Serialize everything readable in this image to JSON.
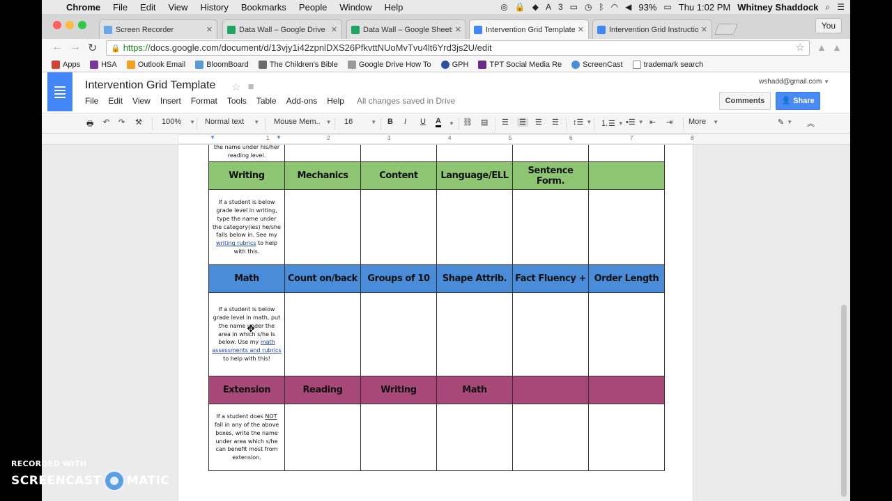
{
  "mac_menubar": {
    "app_name": "Chrome",
    "items": [
      "File",
      "Edit",
      "View",
      "History",
      "Bookmarks",
      "People",
      "Window",
      "Help"
    ],
    "status_badge": "3",
    "battery": "93%",
    "clock": "Thu 1:02 PM",
    "user": "Whitney Shaddock"
  },
  "tabs": [
    {
      "label": "Screen Recorder",
      "icon": "web-icon",
      "color": "#6aa6e8"
    },
    {
      "label": "Data Wall – Google Drive",
      "icon": "drive-icon",
      "color": "#1fa463"
    },
    {
      "label": "Data Wall – Google Sheets",
      "icon": "sheets-icon",
      "color": "#21a366"
    },
    {
      "label": "Intervention Grid Template",
      "icon": "docs-icon",
      "color": "#4285f4"
    },
    {
      "label": "Intervention Grid Instructio",
      "icon": "docs-icon",
      "color": "#4285f4"
    }
  ],
  "profile_button": "You",
  "address_bar": {
    "scheme": "https://",
    "url": "docs.google.com/document/d/13vjy1i42zpnlDXS26PfkvttNUoMvTvu4lt6Yrd3js2U/edit"
  },
  "bookmarks": [
    {
      "label": "Apps",
      "icon": "apps-grid-icon",
      "color": "#d04436"
    },
    {
      "label": "HSA",
      "icon": "hsa-icon",
      "color": "#7a3a99"
    },
    {
      "label": "Outlook Email",
      "icon": "windows-icon",
      "color": "#f1a11f"
    },
    {
      "label": "BloomBoard",
      "icon": "bloomboard-icon",
      "color": "#5b9bd5"
    },
    {
      "label": "The Children's Bible",
      "icon": "cross-icon",
      "color": "#6b6b6b"
    },
    {
      "label": "Google Drive How To",
      "icon": "heart-icon",
      "color": "#9a9a9a"
    },
    {
      "label": "GPH",
      "icon": "gph-icon",
      "color": "#2e4e9e"
    },
    {
      "label": "TPT Social Media Re",
      "icon": "tpt-icon",
      "color": "#6a2a8a"
    },
    {
      "label": "ScreenCast",
      "icon": "screencast-icon",
      "color": "#4a90d9"
    },
    {
      "label": "trademark search",
      "icon": "page-icon",
      "color": "#888888"
    }
  ],
  "doc": {
    "title": "Intervention Grid Template",
    "menu": [
      "File",
      "Edit",
      "View",
      "Insert",
      "Format",
      "Tools",
      "Table",
      "Add-ons",
      "Help"
    ],
    "save_status": "All changes saved in Drive",
    "user_email": "wshadd@gmail.com",
    "comments_label": "Comments",
    "share_label": "Share"
  },
  "toolbar": {
    "zoom": "100%",
    "style": "Normal text",
    "font": "Mouse Mem..",
    "size": "16",
    "bold": "B",
    "italic": "I",
    "underline": "U",
    "text_color": "A",
    "more": "More"
  },
  "ruler_numbers": [
    "1",
    "2",
    "3",
    "4",
    "5",
    "6",
    "7",
    "8"
  ],
  "grid": {
    "top_note": "the name under his/her reading level.",
    "writing": {
      "headers": [
        "Writing",
        "Mechanics",
        "Content",
        "Language/ELL",
        "Sentence Form.",
        ""
      ],
      "note_before": "If a student is below grade level in writing, type the name under the category(ies) he/she falls below in. See my ",
      "note_link": "writing rubrics",
      "note_after": " to help with this."
    },
    "math": {
      "headers": [
        "Math",
        "Count on/back",
        "Groups of 10",
        "Shape Attrib.",
        "Fact Fluency +",
        "Order Length"
      ],
      "note_before": "If a student is below grade level in math, put the name under the area in which s/he is below.  Use my ",
      "note_link": "math assessments and rubrics",
      "note_after": " to help with this!"
    },
    "extension": {
      "headers": [
        "Extension",
        "Reading",
        "Writing",
        "Math",
        "",
        ""
      ],
      "note_before": "If a student does ",
      "note_emph": "NOT",
      "note_after": " fall in any of the above boxes, write the name under area which s/he can benefit most from extension."
    }
  },
  "watermark": {
    "line1": "RECORDED WITH",
    "left": "SCREENCAST",
    "right": "MATIC"
  }
}
